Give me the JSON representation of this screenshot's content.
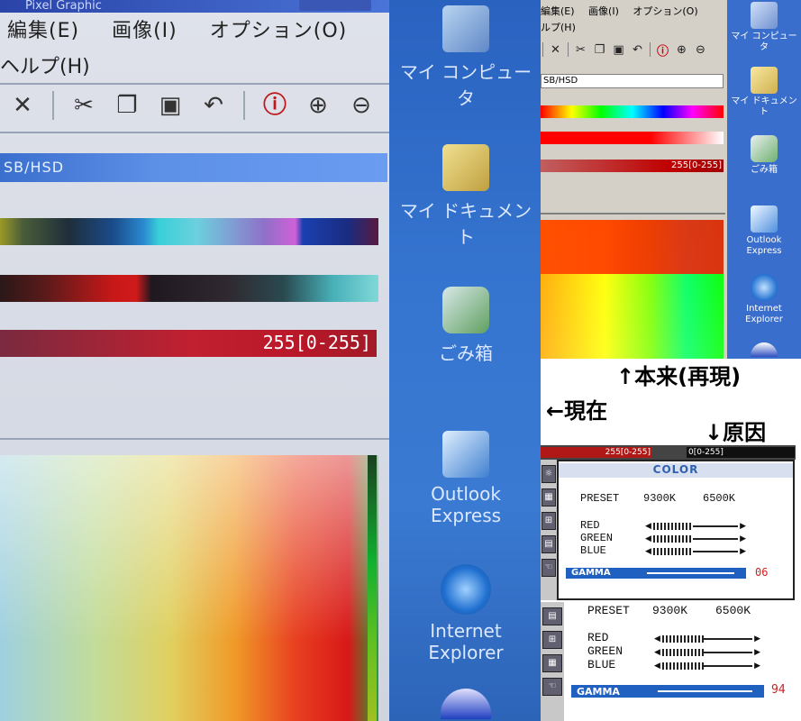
{
  "photo": {
    "window_title": "Pixel Graphic",
    "menu": [
      "編集(E)",
      "画像(I)",
      "オプション(O)"
    ],
    "menu_help": "ヘルプ(H)",
    "field_text": "SB/HSD",
    "slider_value": "255[0-255]",
    "desktop_icons": [
      {
        "label": "マイ コンピュータ",
        "icon": "my-computer-icon"
      },
      {
        "label": "マイ ドキュメント",
        "icon": "my-documents-icon"
      },
      {
        "label": "ごみ箱",
        "icon": "recycle-bin-icon"
      },
      {
        "label": "Outlook Express",
        "icon": "outlook-express-icon"
      },
      {
        "label": "Internet Explorer",
        "icon": "internet-explorer-icon"
      }
    ]
  },
  "screenshot": {
    "menu": [
      "編集(E)",
      "画像(I)",
      "オプション(O)"
    ],
    "menu_help": "ルプ(H)",
    "input_value": "SB/HSD",
    "slider_value": "255[0-255]",
    "desktop_icons": [
      {
        "label": "マイ コンピュータ",
        "icon": "my-computer-icon"
      },
      {
        "label": "マイ ドキュメント",
        "icon": "my-documents-icon"
      },
      {
        "label": "ごみ箱",
        "icon": "recycle-bin-icon"
      },
      {
        "label": "Outlook Express",
        "icon": "outlook-express-icon"
      },
      {
        "label": "Internet Explorer",
        "icon": "internet-explorer-icon"
      }
    ]
  },
  "annotations": {
    "original": "↑本来(再現)",
    "current": "←現在",
    "cause": "↓原因"
  },
  "osd1": {
    "strip_left": "255[0-255]",
    "strip_right": "0[0-255]",
    "title": "COLOR",
    "preset_label": "PRESET",
    "preset_a": "9300K",
    "preset_b": "6500K",
    "red": "RED",
    "green": "GREEN",
    "blue": "BLUE",
    "gamma_label": "GAMMA",
    "gamma_value": "06",
    "gamma_level": 0.95
  },
  "osd2": {
    "preset_label": "PRESET",
    "preset_a": "9300K",
    "preset_b": "6500K",
    "red": "RED",
    "green": "GREEN",
    "blue": "BLUE",
    "gamma_label": "GAMMA",
    "gamma_value": "94",
    "gamma_level": 0.95
  },
  "colors": {
    "desktop_blue": "#3a6ecc",
    "gamma_blue": "#2060c0",
    "gamma_value_red": "#d02020",
    "osd_title_blue": "#3060b0"
  }
}
